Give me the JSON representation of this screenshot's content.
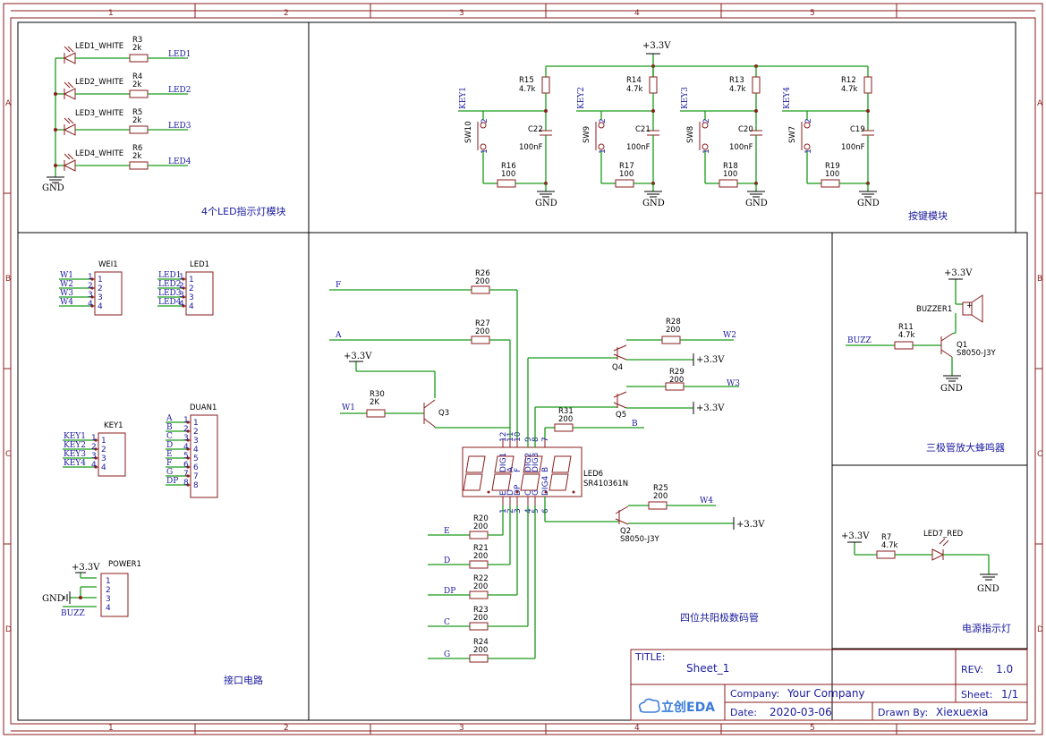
{
  "border": {
    "cols": [
      "1",
      "2",
      "3",
      "4",
      "5"
    ],
    "rows": [
      "A",
      "B",
      "C",
      "D"
    ]
  },
  "modules": {
    "led_block": "4个LED指示灯模块",
    "key_block": "按键模块",
    "interface": "接口电路",
    "display": "四位共阳极数码管",
    "buzzer": "三极管放大蜂鸣器",
    "power_led": "电源指示灯"
  },
  "led_block": {
    "rows": [
      {
        "led": "LED1_WHITE",
        "res": "R3",
        "val": "2k",
        "net": "LED1"
      },
      {
        "led": "LED2_WHITE",
        "res": "R4",
        "val": "2k",
        "net": "LED2"
      },
      {
        "led": "LED3_WHITE",
        "res": "R5",
        "val": "2k",
        "net": "LED3"
      },
      {
        "led": "LED4_WHITE",
        "res": "R6",
        "val": "2k",
        "net": "LED4"
      }
    ],
    "gnd": "GND"
  },
  "key_block": {
    "vcc": "+3.3V",
    "gnd": "GND",
    "cap_val": "100nF",
    "r_top_val": "4.7k",
    "r_bot_val": "100",
    "keys": [
      {
        "net": "KEY1",
        "sw": "SW10",
        "rtop": "R15",
        "cap": "C22",
        "rbot": "R16"
      },
      {
        "net": "KEY2",
        "sw": "SW9",
        "rtop": "R14",
        "cap": "C21",
        "rbot": "R17"
      },
      {
        "net": "KEY3",
        "sw": "SW8",
        "rtop": "R13",
        "cap": "C20",
        "rbot": "R18"
      },
      {
        "net": "KEY4",
        "sw": "SW7",
        "rtop": "R12",
        "cap": "C19",
        "rbot": "R19"
      }
    ]
  },
  "interface": {
    "wei": {
      "ref": "WEI1",
      "nets": [
        "W1",
        "W2",
        "W3",
        "W4"
      ]
    },
    "led": {
      "ref": "LED1",
      "nets": [
        "LED1",
        "LED2",
        "LED3",
        "LED4"
      ]
    },
    "key": {
      "ref": "KEY1",
      "nets": [
        "KEY1",
        "KEY2",
        "KEY3",
        "KEY4"
      ]
    },
    "duan": {
      "ref": "DUAN1",
      "nets": [
        "A",
        "B",
        "C",
        "D",
        "E",
        "F",
        "G",
        "DP"
      ]
    },
    "power": {
      "ref": "POWER1",
      "vcc": "+3.3V",
      "gnd": "GND",
      "buzz": "BUZZ"
    },
    "pins": [
      "1",
      "2",
      "3",
      "4",
      "5",
      "6",
      "7",
      "8"
    ]
  },
  "display": {
    "ref": "LED6",
    "part": "SR410361N",
    "top_pins": [
      "12",
      "11",
      "10",
      "9",
      "8",
      "7"
    ],
    "top_names": [
      "DIG1",
      "A",
      "F",
      "DIG2",
      "DIG3",
      "B"
    ],
    "bot_pins": [
      "1",
      "2",
      "3",
      "4",
      "5",
      "6"
    ],
    "bot_names": [
      "E",
      "D",
      "DP",
      "C",
      "G",
      "DIG4"
    ],
    "seg_res": [
      {
        "ref": "R26",
        "val": "200",
        "net": "F"
      },
      {
        "ref": "R27",
        "val": "200",
        "net": "A"
      },
      {
        "ref": "R31",
        "val": "200",
        "net": "B"
      },
      {
        "ref": "R20",
        "val": "200",
        "net": "E"
      },
      {
        "ref": "R21",
        "val": "200",
        "net": "D"
      },
      {
        "ref": "R22",
        "val": "200",
        "net": "DP"
      },
      {
        "ref": "R23",
        "val": "200",
        "net": "C"
      },
      {
        "ref": "R24",
        "val": "200",
        "net": "G"
      }
    ],
    "drivers": [
      {
        "q": "Q3",
        "r": "R30",
        "rv": "2K",
        "net": "W1"
      },
      {
        "q": "Q4",
        "r": "R28",
        "rv": "200",
        "net": "W2"
      },
      {
        "q": "Q5",
        "r": "R29",
        "rv": "200",
        "net": "W3"
      },
      {
        "q": "Q2",
        "r": "R25",
        "rv": "200",
        "net": "W4",
        "part": "S8050-J3Y"
      }
    ],
    "vcc": "+3.3V"
  },
  "buzzer": {
    "vcc": "+3.3V",
    "ref": "BUZZER1",
    "r": "R11",
    "rv": "4.7k",
    "net": "BUZZ",
    "q": "Q1",
    "qpart": "S8050-J3Y",
    "gnd": "GND",
    "plus": "+"
  },
  "power_led": {
    "vcc": "+3.3V",
    "r": "R7",
    "rv": "4.7k",
    "led": "LED7_RED",
    "gnd": "GND"
  },
  "title_block": {
    "title_label": "TITLE:",
    "title": "Sheet_1",
    "rev_label": "REV:",
    "rev": "1.0",
    "company_label": "Company:",
    "company": "Your Company",
    "sheet_label": "Sheet:",
    "sheet": "1/1",
    "date_label": "Date:",
    "date": "2020-03-06",
    "drawn_label": "Drawn By:",
    "drawn": "Xiexuexia",
    "logo": "立创EDA"
  },
  "colors": {
    "wire": "#1a9a1a",
    "part": "#8b1e1e",
    "net": "#1a1aa0"
  }
}
